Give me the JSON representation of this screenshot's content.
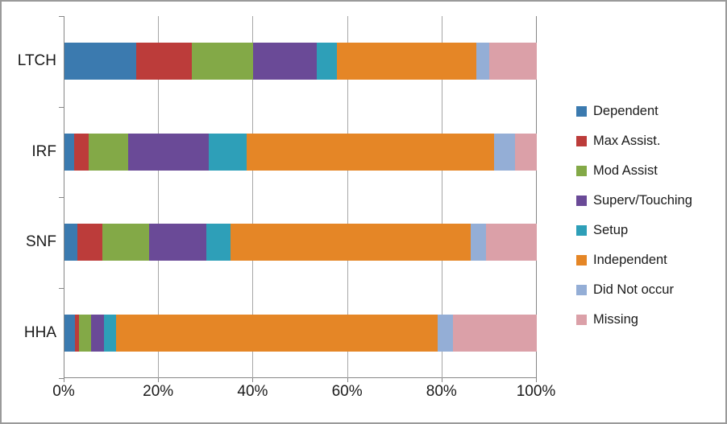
{
  "chart_data": {
    "type": "bar",
    "orientation": "horizontal",
    "stacked": true,
    "stack_mode": "percent",
    "title": "",
    "xlabel": "",
    "ylabel": "",
    "xlim": [
      0,
      100
    ],
    "xticks": [
      "0%",
      "20%",
      "40%",
      "60%",
      "80%",
      "100%"
    ],
    "xtick_values": [
      0,
      20,
      40,
      60,
      80,
      100
    ],
    "grid": true,
    "legend_position": "right",
    "categories": [
      "LTCH",
      "IRF",
      "SNF",
      "HHA"
    ],
    "series": [
      {
        "name": "Dependent",
        "color": "#3b7aaf",
        "values": [
          15.2,
          2.0,
          2.8,
          2.2
        ]
      },
      {
        "name": "Max Assist.",
        "color": "#bc3c3a",
        "values": [
          11.8,
          3.2,
          5.3,
          0.8
        ]
      },
      {
        "name": "Mod Assist",
        "color": "#83a947",
        "values": [
          13.0,
          8.3,
          9.8,
          2.7
        ]
      },
      {
        "name": "Superv/Touching",
        "color": "#6a4a97",
        "values": [
          13.4,
          17.0,
          12.2,
          2.7
        ]
      },
      {
        "name": "Setup",
        "color": "#2e9fb8",
        "values": [
          4.3,
          8.0,
          5.0,
          2.6
        ]
      },
      {
        "name": "Independent",
        "color": "#e58626",
        "values": [
          29.5,
          52.5,
          50.9,
          68.0
        ]
      },
      {
        "name": "Did Not occur",
        "color": "#94aed6",
        "values": [
          2.8,
          4.4,
          3.2,
          3.2
        ]
      },
      {
        "name": "Missing",
        "color": "#dba0a8",
        "values": [
          10.0,
          4.6,
          10.8,
          17.8
        ]
      }
    ]
  },
  "axis": {
    "category_labels": [
      "LTCH",
      "IRF",
      "SNF",
      "HHA"
    ],
    "x_tick_labels": [
      "0%",
      "20%",
      "40%",
      "60%",
      "80%",
      "100%"
    ]
  },
  "legend": {
    "entries": [
      {
        "label": "Dependent",
        "color": "#3b7aaf"
      },
      {
        "label": "Max Assist.",
        "color": "#bc3c3a"
      },
      {
        "label": "Mod Assist",
        "color": "#83a947"
      },
      {
        "label": "Superv/Touching",
        "color": "#6a4a97"
      },
      {
        "label": "Setup",
        "color": "#2e9fb8"
      },
      {
        "label": "Independent",
        "color": "#e58626"
      },
      {
        "label": "Did Not occur",
        "color": "#94aed6"
      },
      {
        "label": "Missing",
        "color": "#dba0a8"
      }
    ]
  }
}
